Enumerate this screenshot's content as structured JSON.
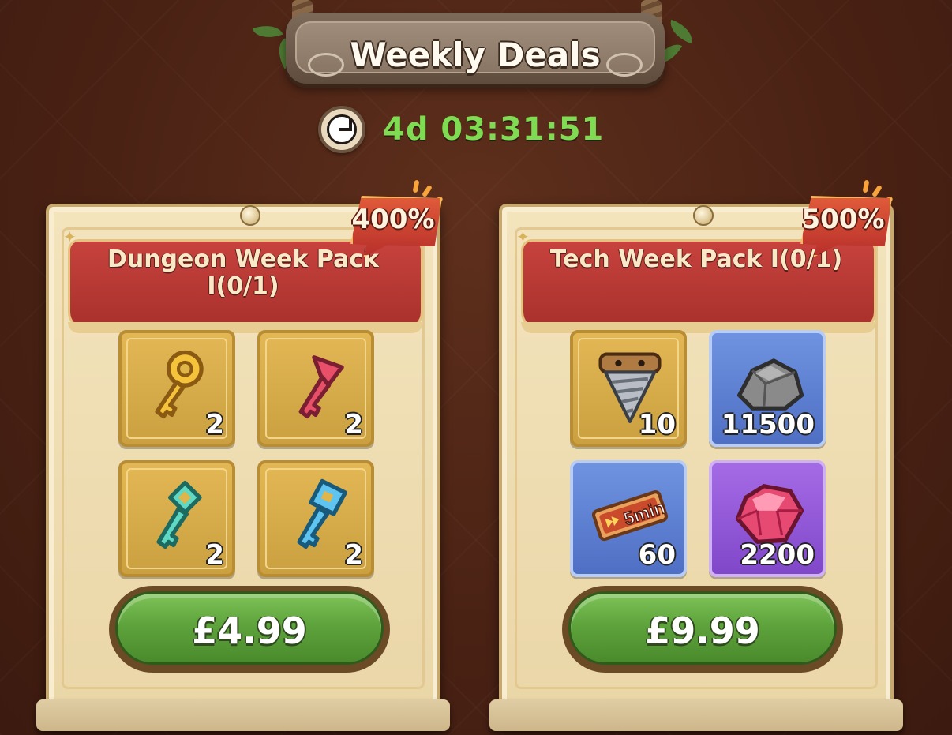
{
  "header": {
    "title": "Weekly Deals"
  },
  "timer": {
    "value": "4d 03:31:51",
    "color": "#7fdc52",
    "icon": "clock-icon"
  },
  "packs": [
    {
      "title": "Dungeon Week Pack I(0/1)",
      "bonus": "400%",
      "price": "£4.99",
      "items": [
        {
          "name": "gold-key",
          "qty": "2",
          "rarity": "gold"
        },
        {
          "name": "red-key",
          "qty": "2",
          "rarity": "gold"
        },
        {
          "name": "teal-key",
          "qty": "2",
          "rarity": "gold"
        },
        {
          "name": "blue-key",
          "qty": "2",
          "rarity": "gold"
        }
      ]
    },
    {
      "title": "Tech Week Pack I(0/1)",
      "bonus": "500%",
      "price": "£9.99",
      "items": [
        {
          "name": "drill-bit",
          "qty": "10",
          "rarity": "gold"
        },
        {
          "name": "stone-ore",
          "qty": "11500",
          "rarity": "blue"
        },
        {
          "name": "speedup-ticket",
          "qty": "60",
          "rarity": "blue",
          "label": "5min"
        },
        {
          "name": "red-gem",
          "qty": "2200",
          "rarity": "purple"
        }
      ]
    }
  ],
  "colors": {
    "button": "#5ea33c",
    "banner": "#b8302a",
    "card": "#f3e4bd"
  }
}
